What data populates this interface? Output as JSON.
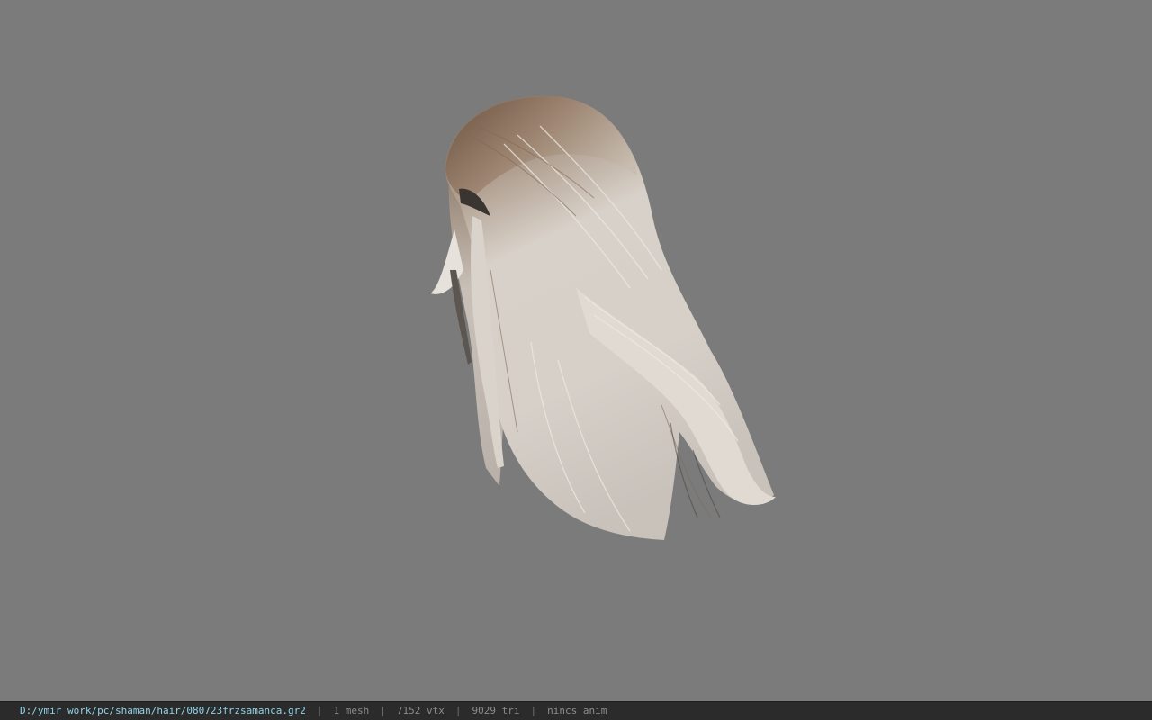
{
  "viewer": {
    "background_color": "#7b7b7b",
    "status_bar": {
      "file_path": "D:/ymir work/pc/shaman/hair/080723frzsamanca.gr2",
      "separator": "|",
      "mesh_count": "1 mesh",
      "vertex_count": "7152 vtx",
      "triangle_count": "9029 tri",
      "anim_status": "nincs anim"
    }
  }
}
